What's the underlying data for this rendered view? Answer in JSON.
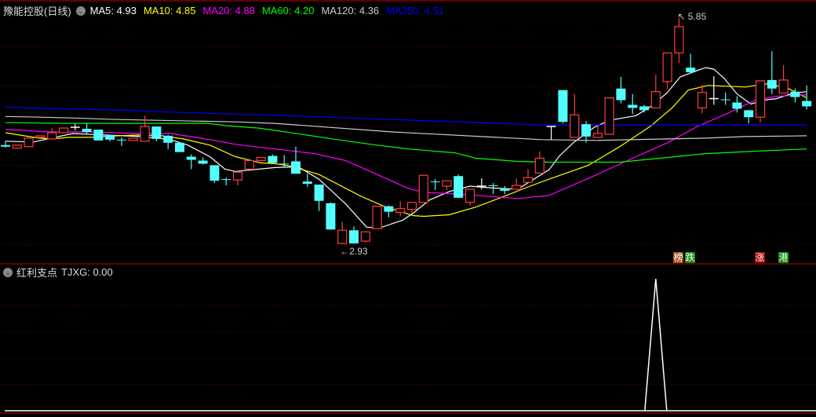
{
  "header": {
    "title": "豫能控股(日线)",
    "ma": [
      {
        "label": "MA5: 4.93",
        "color": "#ffffff"
      },
      {
        "label": "MA10: 4.85",
        "color": "#ffff00"
      },
      {
        "label": "MA20: 4.88",
        "color": "#ff00ff"
      },
      {
        "label": "MA60: 4.20",
        "color": "#00ff00"
      },
      {
        "label": "MA120: 4.36",
        "color": "#cccccc"
      },
      {
        "label": "MA250: 4.51",
        "color": "#0000ff"
      }
    ]
  },
  "annotations": {
    "high_label": "5.85",
    "low_label": "2.93",
    "high_arrow": "↖",
    "low_arrow": "←"
  },
  "badges": [
    {
      "text": "榜",
      "color": "#a0521e"
    },
    {
      "text": "跌",
      "color": "#0a8a0a"
    },
    {
      "text": "涨",
      "color": "#9a0000"
    },
    {
      "text": "港",
      "color": "#0a8a0a"
    }
  ],
  "indicator": {
    "title": "红利支点",
    "value_label": "TJXG: 0.00"
  },
  "colors": {
    "up": "#ff3c3c",
    "down": "#54ffff",
    "flat": "#ffffff",
    "grid": "#8b0000",
    "border": "#c00000"
  },
  "chart_data": {
    "type": "candlestick",
    "price_range": [
      2.93,
      5.85
    ],
    "candles_ohlc": [
      [
        4.21,
        4.26,
        4.18,
        4.19
      ],
      [
        4.17,
        4.21,
        4.17,
        4.21
      ],
      [
        4.19,
        4.3,
        4.19,
        4.3
      ],
      [
        4.31,
        4.33,
        4.31,
        4.33
      ],
      [
        4.29,
        4.43,
        4.29,
        4.37
      ],
      [
        4.37,
        4.43,
        4.37,
        4.43
      ],
      [
        4.44,
        4.48,
        4.4,
        4.44
      ],
      [
        4.42,
        4.49,
        4.35,
        4.38
      ],
      [
        4.41,
        4.41,
        4.27,
        4.27
      ],
      [
        4.34,
        4.34,
        4.26,
        4.28
      ],
      [
        4.28,
        4.31,
        4.2,
        4.27
      ],
      [
        4.27,
        4.3,
        4.27,
        4.3
      ],
      [
        4.26,
        4.59,
        4.26,
        4.45
      ],
      [
        4.45,
        4.45,
        4.26,
        4.29
      ],
      [
        4.33,
        4.34,
        4.16,
        4.24
      ],
      [
        4.24,
        4.24,
        4.12,
        4.12
      ],
      [
        4.06,
        4.09,
        3.9,
        4.02
      ],
      [
        4.01,
        4.05,
        3.96,
        3.97
      ],
      [
        3.95,
        3.95,
        3.72,
        3.75
      ],
      [
        3.77,
        3.79,
        3.69,
        3.76
      ],
      [
        3.76,
        3.86,
        3.69,
        3.86
      ],
      [
        3.9,
        4.01,
        3.9,
        4.01
      ],
      [
        4.01,
        4.05,
        4.01,
        4.05
      ],
      [
        4.07,
        4.09,
        3.98,
        3.98
      ],
      [
        3.97,
        4.08,
        3.93,
        3.96
      ],
      [
        4.0,
        4.19,
        3.84,
        3.84
      ],
      [
        3.74,
        3.84,
        3.67,
        3.71
      ],
      [
        3.7,
        3.7,
        3.36,
        3.49
      ],
      [
        3.46,
        3.47,
        3.12,
        3.12
      ],
      [
        2.94,
        3.22,
        2.93,
        3.11
      ],
      [
        3.11,
        3.16,
        2.94,
        2.94
      ],
      [
        2.97,
        3.09,
        2.95,
        3.09
      ],
      [
        3.13,
        3.42,
        3.13,
        3.42
      ],
      [
        3.42,
        3.43,
        3.28,
        3.35
      ],
      [
        3.34,
        3.49,
        3.29,
        3.39
      ],
      [
        3.38,
        3.47,
        3.33,
        3.47
      ],
      [
        3.47,
        3.82,
        3.47,
        3.82
      ],
      [
        3.74,
        3.77,
        3.63,
        3.73
      ],
      [
        3.68,
        3.75,
        3.63,
        3.75
      ],
      [
        3.81,
        3.83,
        3.53,
        3.53
      ],
      [
        3.47,
        3.64,
        3.43,
        3.64
      ],
      [
        3.68,
        3.78,
        3.64,
        3.68
      ],
      [
        3.69,
        3.72,
        3.58,
        3.68
      ],
      [
        3.65,
        3.68,
        3.58,
        3.62
      ],
      [
        3.64,
        3.78,
        3.64,
        3.69
      ],
      [
        3.73,
        3.9,
        3.73,
        3.79
      ],
      [
        3.85,
        4.13,
        3.85,
        4.04
      ],
      [
        4.45,
        4.45,
        4.28,
        4.45
      ],
      [
        4.92,
        4.92,
        4.49,
        4.51
      ],
      [
        4.31,
        4.87,
        4.31,
        4.6
      ],
      [
        4.48,
        4.52,
        4.24,
        4.32
      ],
      [
        4.31,
        4.45,
        4.31,
        4.36
      ],
      [
        4.35,
        4.82,
        4.35,
        4.82
      ],
      [
        4.94,
        5.09,
        4.75,
        4.79
      ],
      [
        4.73,
        4.87,
        4.61,
        4.69
      ],
      [
        4.71,
        4.73,
        4.63,
        4.66
      ],
      [
        4.69,
        5.12,
        4.69,
        4.9
      ],
      [
        5.03,
        5.4,
        4.93,
        5.4
      ],
      [
        5.4,
        5.85,
        5.27,
        5.74
      ],
      [
        5.21,
        5.39,
        5.15,
        5.15
      ],
      [
        4.69,
        4.99,
        4.62,
        4.89
      ],
      [
        4.81,
        5.1,
        4.73,
        4.81
      ],
      [
        4.8,
        4.89,
        4.73,
        4.79
      ],
      [
        4.76,
        4.84,
        4.63,
        4.68
      ],
      [
        4.66,
        4.66,
        4.49,
        4.57
      ],
      [
        4.57,
        5.04,
        4.5,
        5.04
      ],
      [
        5.05,
        5.42,
        4.87,
        4.94
      ],
      [
        4.88,
        5.24,
        4.88,
        5.05
      ],
      [
        4.9,
        4.94,
        4.76,
        4.83
      ],
      [
        4.78,
        4.98,
        4.67,
        4.71
      ]
    ],
    "high_index": 58,
    "low_index": 29,
    "ma_series": [
      {
        "name": "MA5",
        "color": "#ffffff",
        "points": [
          [
            0,
            4.26
          ],
          [
            2.4,
            4.25
          ],
          [
            5.8,
            4.36
          ],
          [
            8.5,
            4.34
          ],
          [
            11.7,
            4.32
          ],
          [
            14.2,
            4.28
          ],
          [
            15.7,
            4.21
          ],
          [
            17.6,
            4.06
          ],
          [
            18.9,
            3.9
          ],
          [
            19.8,
            3.87
          ],
          [
            23.2,
            3.92
          ],
          [
            25.2,
            3.93
          ],
          [
            27,
            3.77
          ],
          [
            29.3,
            3.45
          ],
          [
            31.1,
            3.15
          ],
          [
            32.2,
            3.14
          ],
          [
            34.2,
            3.24
          ],
          [
            35.1,
            3.33
          ],
          [
            36.5,
            3.5
          ],
          [
            38.2,
            3.61
          ],
          [
            40,
            3.68
          ],
          [
            41.6,
            3.66
          ],
          [
            44.1,
            3.64
          ],
          [
            46.8,
            3.89
          ],
          [
            47.7,
            4.07
          ],
          [
            48.9,
            4.24
          ],
          [
            50.7,
            4.44
          ],
          [
            52,
            4.53
          ],
          [
            54.3,
            4.59
          ],
          [
            55.8,
            4.73
          ],
          [
            57,
            4.89
          ],
          [
            58.1,
            5.09
          ],
          [
            59.7,
            5.18
          ],
          [
            60.3,
            5.21
          ],
          [
            61,
            5.19
          ],
          [
            61.9,
            5.07
          ],
          [
            63,
            4.87
          ],
          [
            64.2,
            4.74
          ],
          [
            65.3,
            4.79
          ],
          [
            66.4,
            4.81
          ],
          [
            67.8,
            4.88
          ],
          [
            69,
            4.9
          ]
        ]
      },
      {
        "name": "MA10",
        "color": "#ffff00",
        "points": [
          [
            0,
            4.37
          ],
          [
            1.6,
            4.33
          ],
          [
            2.9,
            4.3
          ],
          [
            4.1,
            4.29
          ],
          [
            5.4,
            4.31
          ],
          [
            7.4,
            4.31
          ],
          [
            9.7,
            4.33
          ],
          [
            11.5,
            4.34
          ],
          [
            13.5,
            4.33
          ],
          [
            15.3,
            4.29
          ],
          [
            17.6,
            4.21
          ],
          [
            19.8,
            4.06
          ],
          [
            22,
            3.98
          ],
          [
            23.2,
            3.97
          ],
          [
            24.5,
            3.94
          ],
          [
            27,
            3.83
          ],
          [
            30.6,
            3.55
          ],
          [
            32.6,
            3.42
          ],
          [
            35.1,
            3.3
          ],
          [
            36,
            3.29
          ],
          [
            38.2,
            3.31
          ],
          [
            40.5,
            3.41
          ],
          [
            42.8,
            3.54
          ],
          [
            45,
            3.67
          ],
          [
            46.8,
            3.77
          ],
          [
            50.2,
            3.95
          ],
          [
            52.9,
            4.19
          ],
          [
            55.6,
            4.46
          ],
          [
            57.4,
            4.69
          ],
          [
            58.8,
            4.92
          ],
          [
            60.5,
            4.98
          ],
          [
            63.7,
            4.96
          ],
          [
            65.5,
            5.0
          ],
          [
            67.3,
            4.95
          ],
          [
            69,
            4.82
          ]
        ]
      },
      {
        "name": "MA20",
        "color": "#ff00ff",
        "points": [
          [
            0,
            4.41
          ],
          [
            1.6,
            4.4
          ],
          [
            3.6,
            4.38
          ],
          [
            7.4,
            4.38
          ],
          [
            11.5,
            4.36
          ],
          [
            14.2,
            4.36
          ],
          [
            16.4,
            4.31
          ],
          [
            18.4,
            4.26
          ],
          [
            19.8,
            4.22
          ],
          [
            22,
            4.18
          ],
          [
            23.2,
            4.16
          ],
          [
            26.6,
            4.1
          ],
          [
            29.3,
            4.01
          ],
          [
            32,
            3.83
          ],
          [
            34.7,
            3.65
          ],
          [
            36,
            3.6
          ],
          [
            38.7,
            3.58
          ],
          [
            41.4,
            3.55
          ],
          [
            44.1,
            3.52
          ],
          [
            46.8,
            3.56
          ],
          [
            50.5,
            3.8
          ],
          [
            54.3,
            4.06
          ],
          [
            57,
            4.24
          ],
          [
            59.7,
            4.46
          ],
          [
            61.9,
            4.6
          ],
          [
            64.6,
            4.79
          ],
          [
            66.4,
            4.84
          ],
          [
            69,
            4.86
          ]
        ]
      },
      {
        "name": "MA60",
        "color": "#00ff00",
        "points": [
          [
            0,
            4.5
          ],
          [
            5.6,
            4.49
          ],
          [
            17.4,
            4.49
          ],
          [
            19.1,
            4.46
          ],
          [
            21.8,
            4.43
          ],
          [
            23.2,
            4.4
          ],
          [
            29.5,
            4.26
          ],
          [
            32,
            4.21
          ],
          [
            34.7,
            4.16
          ],
          [
            38.7,
            4.11
          ],
          [
            40.5,
            4.04
          ],
          [
            44.1,
            4.0
          ],
          [
            46.8,
            3.99
          ],
          [
            52.9,
            3.99
          ],
          [
            58.3,
            4.07
          ],
          [
            60.3,
            4.1
          ],
          [
            64.4,
            4.13
          ],
          [
            69,
            4.16
          ]
        ]
      },
      {
        "name": "MA120",
        "color": "#cccccc",
        "points": [
          [
            0,
            4.58
          ],
          [
            2.9,
            4.57
          ],
          [
            5.6,
            4.56
          ],
          [
            9.7,
            4.54
          ],
          [
            13.0,
            4.53
          ],
          [
            19.8,
            4.51
          ],
          [
            23.2,
            4.49
          ],
          [
            33.3,
            4.38
          ],
          [
            46.2,
            4.28
          ],
          [
            50.9,
            4.27
          ],
          [
            57,
            4.29
          ],
          [
            60.3,
            4.3
          ],
          [
            63.7,
            4.32
          ],
          [
            69,
            4.33
          ]
        ]
      },
      {
        "name": "MA250",
        "color": "#0000ff",
        "points": [
          [
            0,
            4.7
          ],
          [
            1.6,
            4.69
          ],
          [
            4.5,
            4.68
          ],
          [
            7.5,
            4.67
          ],
          [
            10.5,
            4.66
          ],
          [
            13.5,
            4.64
          ],
          [
            15.5,
            4.63
          ],
          [
            17.6,
            4.62
          ],
          [
            19.6,
            4.61
          ],
          [
            22.5,
            4.6
          ],
          [
            33.3,
            4.54
          ],
          [
            46.2,
            4.47
          ],
          [
            69,
            4.47
          ]
        ]
      }
    ],
    "indicator_series": {
      "name": "TJXG",
      "values_nonzero": {
        "56": 1
      },
      "ylim": [
        0,
        1
      ]
    }
  }
}
